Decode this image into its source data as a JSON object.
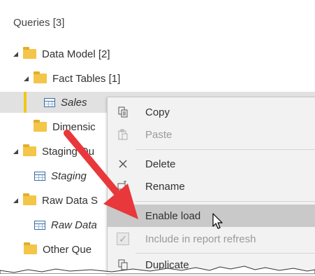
{
  "panel": {
    "title": "Queries [3]"
  },
  "tree": [
    {
      "label": "Data Model [2]",
      "icon": "folder-icon",
      "expanded": true
    },
    {
      "label": "Fact Tables [1]",
      "icon": "folder-icon",
      "expanded": true
    },
    {
      "label": "Sales",
      "icon": "table-icon",
      "selected": true
    },
    {
      "label": "Dimensic",
      "icon": "folder-icon"
    },
    {
      "label": "Staging Qu",
      "icon": "folder-icon",
      "expanded": true
    },
    {
      "label": "Staging",
      "icon": "table-icon"
    },
    {
      "label": "Raw Data S",
      "icon": "folder-icon",
      "expanded": true
    },
    {
      "label": "Raw Data",
      "icon": "table-icon"
    },
    {
      "label": "Other Que",
      "icon": "folder-icon"
    }
  ],
  "context_menu": {
    "items": [
      {
        "label": "Copy",
        "icon": "copy-icon",
        "enabled": true
      },
      {
        "label": "Paste",
        "icon": "paste-icon",
        "enabled": false
      },
      {
        "label": "Delete",
        "icon": "delete-icon",
        "enabled": true
      },
      {
        "label": "Rename",
        "icon": "rename-icon",
        "enabled": true
      },
      {
        "label": "Enable load",
        "icon": "none",
        "enabled": true,
        "hovered": true
      },
      {
        "label": "Include in report refresh",
        "icon": "checkbox-icon",
        "enabled": false,
        "checked": true
      },
      {
        "label": "Duplicate",
        "icon": "duplicate-icon",
        "enabled": true
      }
    ]
  },
  "colors": {
    "folder": "#f3c549",
    "selection_accent": "#f2c811",
    "annotation_arrow": "#e8383b",
    "menu_background": "#f2f2f2",
    "menu_hover": "#c9c9c9"
  }
}
